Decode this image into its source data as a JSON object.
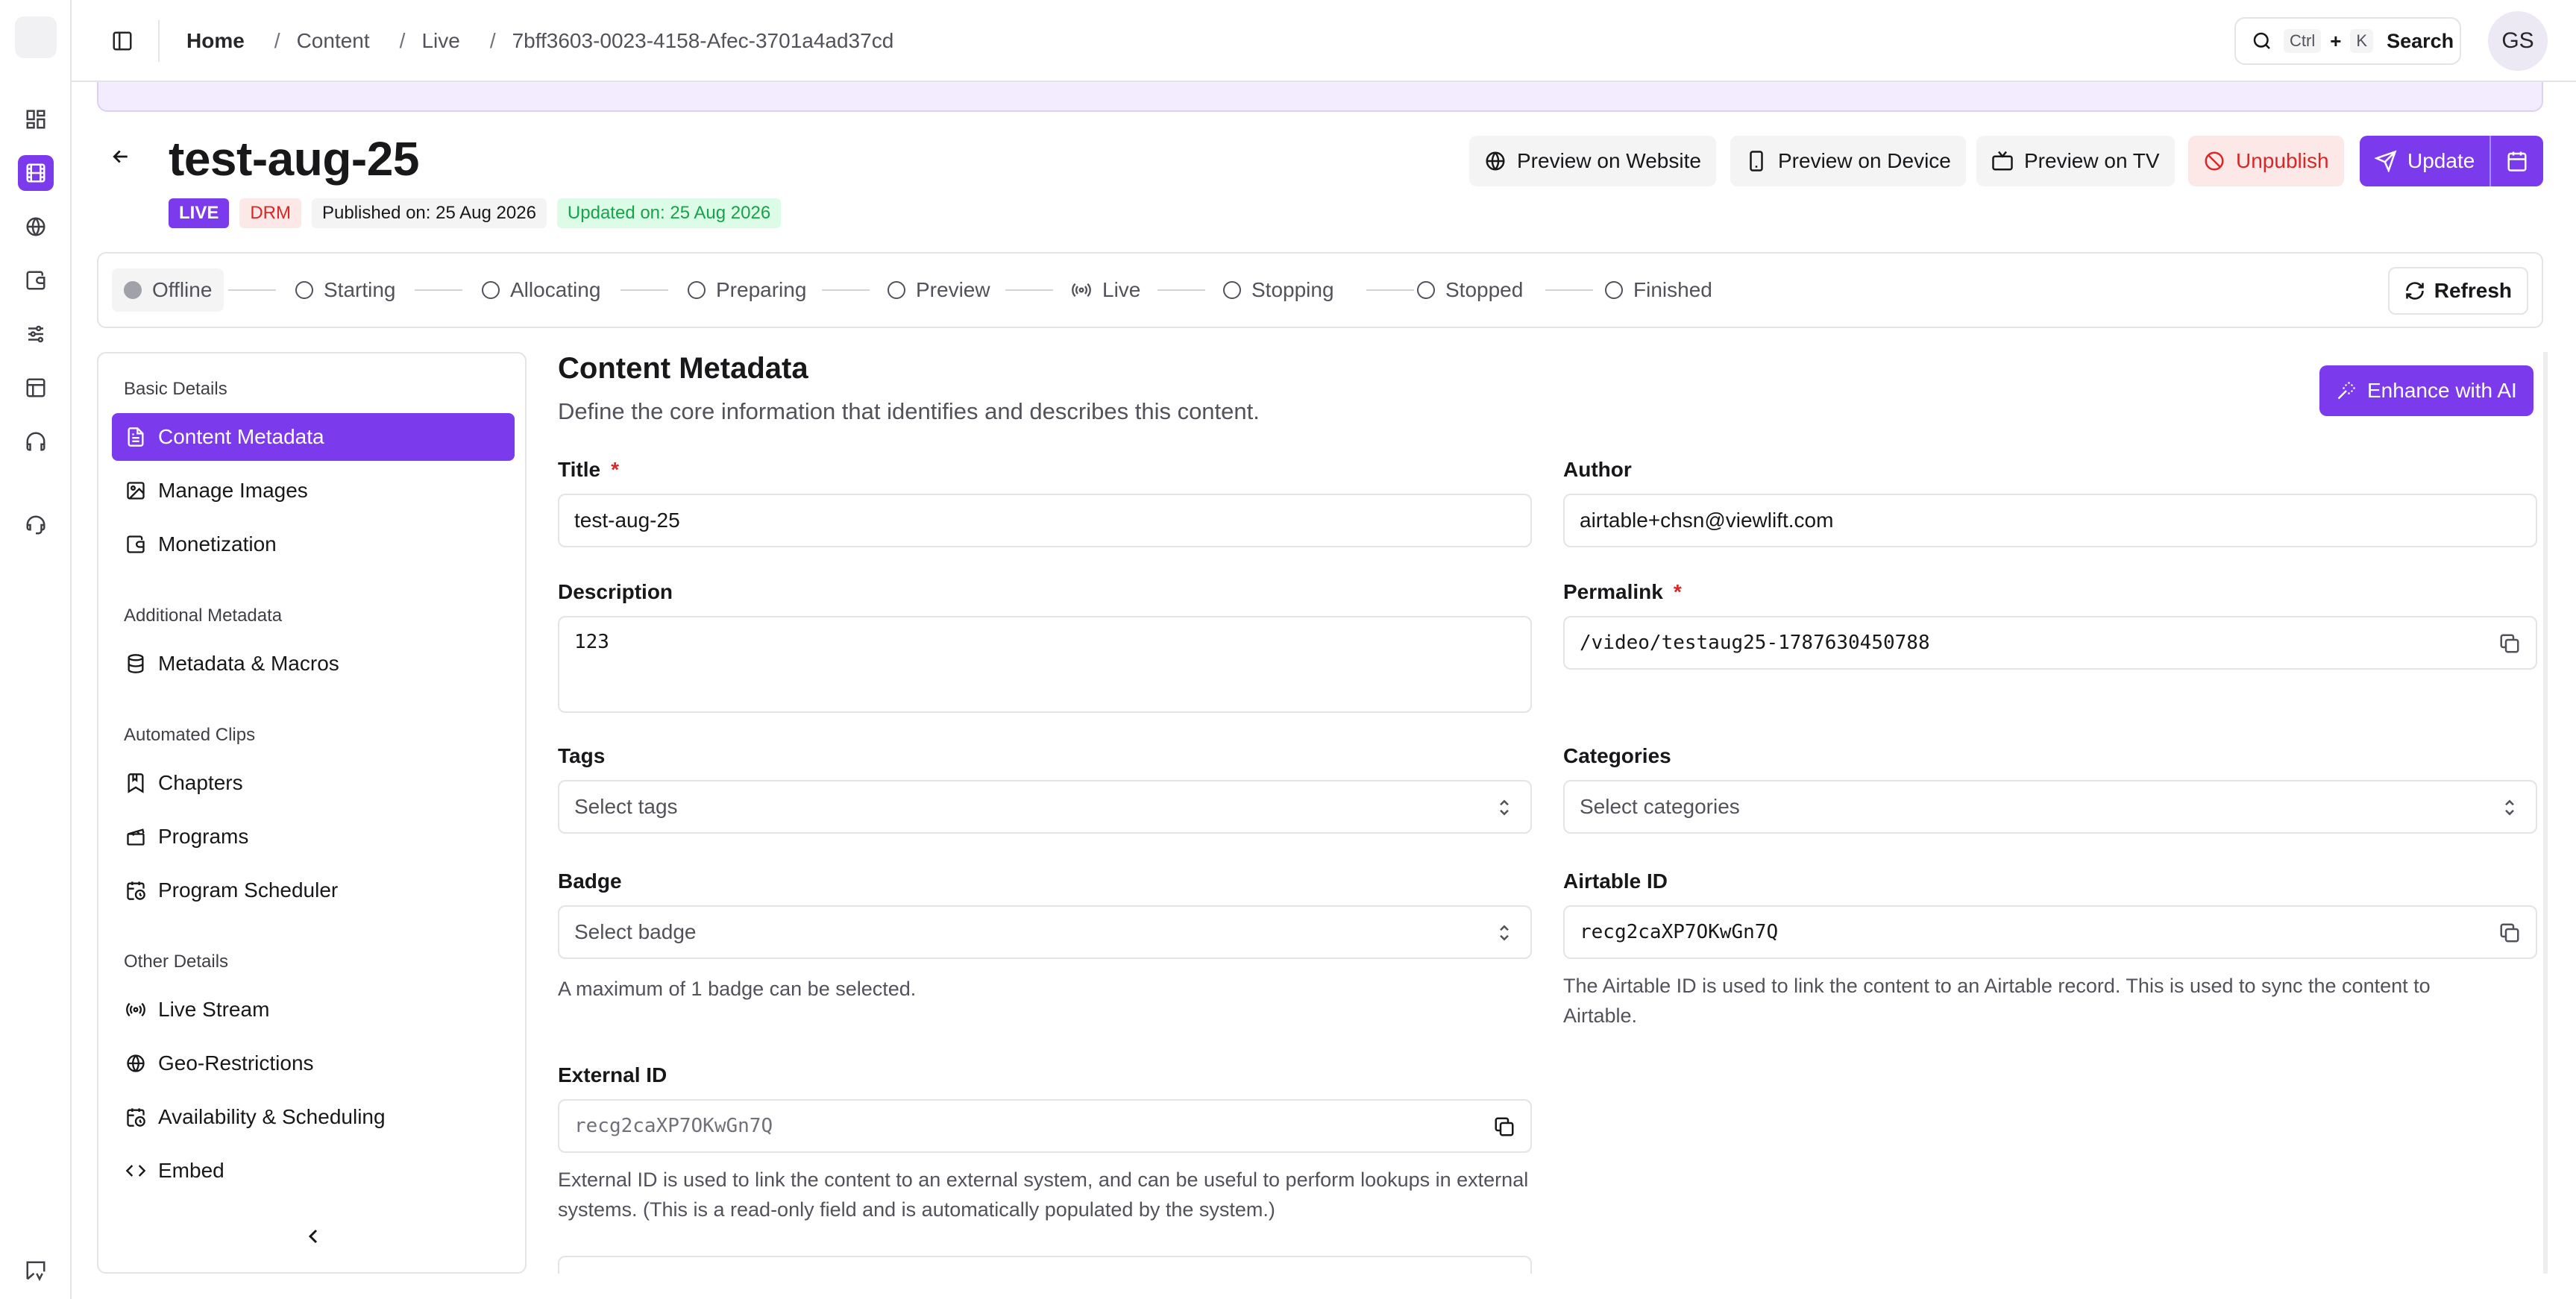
{
  "breadcrumb": {
    "home": "Home",
    "items": [
      "Content",
      "Live",
      "7bff3603-0023-4158-Afec-3701a4ad37cd"
    ]
  },
  "search": {
    "key1": "Ctrl",
    "plus": "+",
    "key2": "K",
    "label": "Search"
  },
  "user": {
    "initials": "GS"
  },
  "header": {
    "title": "test-aug-25",
    "badges": {
      "live": "LIVE",
      "drm": "DRM",
      "published": "Published on: 25 Aug 2026",
      "updated": "Updated on: 25 Aug 2026"
    },
    "actions": {
      "preview_website": "Preview on Website",
      "preview_device": "Preview on Device",
      "preview_tv": "Preview on TV",
      "unpublish": "Unpublish",
      "update": "Update"
    }
  },
  "status": {
    "steps": [
      "Offline",
      "Starting",
      "Allocating",
      "Preparing",
      "Preview",
      "Live",
      "Stopping",
      "Stopped",
      "Finished"
    ],
    "current": "Offline",
    "refresh": "Refresh"
  },
  "sidenav": {
    "groups": [
      "Basic Details",
      "Additional Metadata",
      "Automated Clips",
      "Other Details"
    ],
    "items": [
      {
        "label": "Content Metadata",
        "icon": "file-text-icon",
        "active": true
      },
      {
        "label": "Manage Images",
        "icon": "image-icon"
      },
      {
        "label": "Monetization",
        "icon": "wallet-icon"
      },
      {
        "label": "Metadata & Macros",
        "icon": "database-icon"
      },
      {
        "label": "Chapters",
        "icon": "bookmark-icon"
      },
      {
        "label": "Programs",
        "icon": "clapperboard-icon"
      },
      {
        "label": "Program Scheduler",
        "icon": "calendar-clock-icon"
      },
      {
        "label": "Live Stream",
        "icon": "radio-icon"
      },
      {
        "label": "Geo-Restrictions",
        "icon": "globe-icon"
      },
      {
        "label": "Availability & Scheduling",
        "icon": "calendar-clock-icon"
      },
      {
        "label": "Embed",
        "icon": "code-icon"
      }
    ]
  },
  "main": {
    "heading": "Content Metadata",
    "subheading": "Define the core information that identifies and describes this content.",
    "enhance": "Enhance with AI",
    "fields": {
      "title": {
        "label": "Title",
        "required": "*",
        "value": "test-aug-25"
      },
      "author": {
        "label": "Author",
        "value": "airtable+chsn@viewlift.com"
      },
      "description": {
        "label": "Description",
        "value": "123"
      },
      "permalink": {
        "label": "Permalink",
        "required": "*",
        "value": "/video/testaug25-1787630450788"
      },
      "tags": {
        "label": "Tags",
        "placeholder": "Select tags"
      },
      "categories": {
        "label": "Categories",
        "placeholder": "Select categories"
      },
      "badge": {
        "label": "Badge",
        "placeholder": "Select badge",
        "help": "A maximum of 1 badge can be selected."
      },
      "airtable_id": {
        "label": "Airtable ID",
        "value": "recg2caXP7OKwGn7Q",
        "help": "The Airtable ID is used to link the content to an Airtable record. This is used to sync the content to Airtable."
      },
      "external_id": {
        "label": "External ID",
        "value": "recg2caXP7OKwGn7Q",
        "help": "External ID is used to link the content to an external system, and can be useful to perform lookups in external systems. (This is a read-only field and is automatically populated by the system.)"
      }
    }
  },
  "colors": {
    "accent": "#7c3aed",
    "danger": "#dc2626",
    "success": "#16a34a"
  }
}
